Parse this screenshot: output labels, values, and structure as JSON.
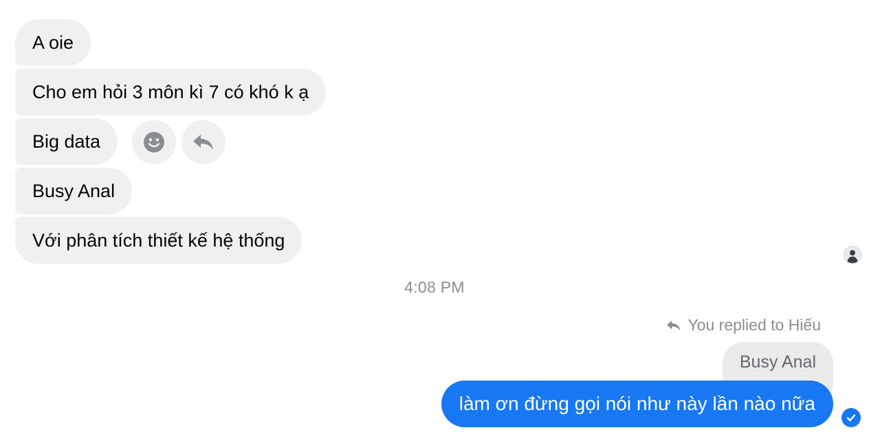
{
  "messages_incoming": [
    {
      "text": "A oie"
    },
    {
      "text": "Cho em hỏi 3 môn kì 7 có khó k ạ"
    },
    {
      "text": "Big data"
    },
    {
      "text": "Busy Anal"
    },
    {
      "text": "Với phân tích thiết kế hệ thống"
    }
  ],
  "actions": {
    "react_icon": "smiley-icon",
    "reply_icon": "reply-arrow-icon"
  },
  "timestamp": "4:08 PM",
  "reply": {
    "header": "You replied to Hiếu",
    "quoted_text": "Busy Anal",
    "message": "làm ơn đừng gọi nói như này lần nào nữa"
  },
  "colors": {
    "incoming_bubble": "#f0f0f0",
    "outgoing_bubble": "#1877f2",
    "meta_text": "#8a8d91"
  }
}
